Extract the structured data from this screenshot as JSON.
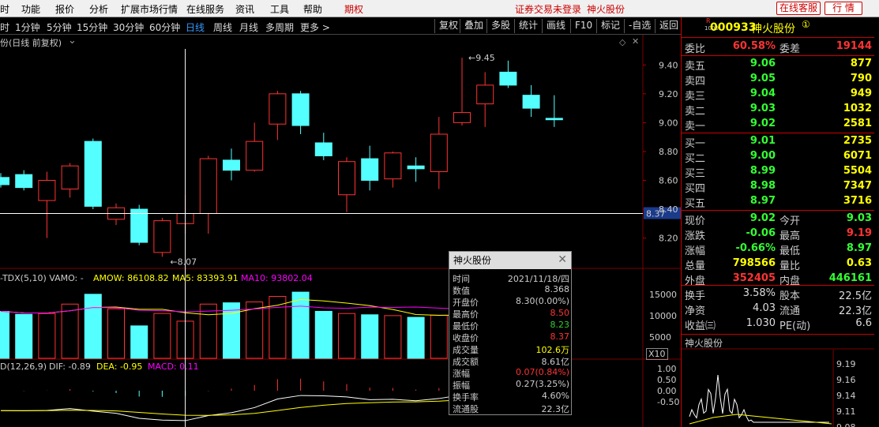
{
  "menu": {
    "items": [
      "时",
      "功能",
      "报价",
      "分析",
      "扩展市场行情",
      "在线服务",
      "资讯",
      "工具",
      "帮助"
    ],
    "qiquan": "期权",
    "status": "证券交易未登录",
    "stock_name": "神火股份",
    "service_btn": "在线客服",
    "quote_btn": "行 情"
  },
  "periods": {
    "items": [
      "时",
      "1分钟",
      "5分钟",
      "15分钟",
      "30分钟",
      "60分钟",
      "日线",
      "周线",
      "月线",
      "多周期",
      "更多 >"
    ],
    "active": "日线",
    "tools": [
      "复权",
      "叠加",
      "多股",
      "统计",
      "画线",
      "F10",
      "标记",
      "-自选",
      "返回"
    ]
  },
  "chart": {
    "title": "份(日线 前复权)",
    "price_ticks": [
      "9.40",
      "9.20",
      "9.00",
      "8.80",
      "8.60",
      "8.40",
      "8.20"
    ],
    "current_price_label": "8.37",
    "high_annotation": "9.45",
    "low_annotation": "8.07",
    "volume_ticks": [
      "15000",
      "10000",
      "5000"
    ],
    "volume_unit": "X10",
    "macd_ticks": [
      "1.00",
      "0.50",
      "0.00",
      "-0.50"
    ],
    "vol_indicator": {
      "name": "-TDX(5,10) VAMO: -",
      "amow": "AMOW: 86108.82",
      "ma5": "MA5: 83393.91",
      "ma10": "MA10: 93802.04"
    },
    "macd_indicator": {
      "name": "D(12,26,9)",
      "dif": "DIF: -0.89",
      "dea": "DEA: -0.95",
      "macd": "MACD: 0.11"
    }
  },
  "infobox": {
    "title": "神火股份",
    "rows": [
      {
        "k": "时间",
        "v": "2021/11/18/四",
        "color": "#cccccc"
      },
      {
        "k": "数值",
        "v": "8.368",
        "color": "#cccccc"
      },
      {
        "k": "开盘价",
        "v": "8.30(0.00%)",
        "color": "#cccccc"
      },
      {
        "k": "最高价",
        "v": "8.50",
        "color": "#ff3333"
      },
      {
        "k": "最低价",
        "v": "8.23",
        "color": "#33cc33"
      },
      {
        "k": "收盘价",
        "v": "8.37",
        "color": "#ff3333"
      },
      {
        "k": "成交量",
        "v": "102.6万",
        "color": "#ffff00"
      },
      {
        "k": "成交额",
        "v": "8.61亿",
        "color": "#cccccc"
      },
      {
        "k": "涨幅",
        "v": "0.07(0.84%)",
        "color": "#ff3333"
      },
      {
        "k": "振幅",
        "v": "0.27(3.25%)",
        "color": "#cccccc"
      },
      {
        "k": "换手率",
        "v": "4.60%",
        "color": "#cccccc"
      },
      {
        "k": "流通股",
        "v": "22.3亿",
        "color": "#cccccc"
      }
    ]
  },
  "quote": {
    "badge_top": "R",
    "badge_bottom": "1000",
    "code": "000933",
    "name": "神火股份",
    "circle": "①",
    "weibi_label": "委比",
    "weibi": "60.58%",
    "weicha_label": "委差",
    "weicha": "19144",
    "asks": [
      {
        "label": "卖五",
        "price": "9.06",
        "vol": "877"
      },
      {
        "label": "卖四",
        "price": "9.05",
        "vol": "790"
      },
      {
        "label": "卖三",
        "price": "9.04",
        "vol": "949"
      },
      {
        "label": "卖二",
        "price": "9.03",
        "vol": "1032"
      },
      {
        "label": "卖一",
        "price": "9.02",
        "vol": "2581"
      }
    ],
    "bids": [
      {
        "label": "买一",
        "price": "9.01",
        "vol": "2735"
      },
      {
        "label": "买二",
        "price": "9.00",
        "vol": "6071"
      },
      {
        "label": "买三",
        "price": "8.99",
        "vol": "5504"
      },
      {
        "label": "买四",
        "price": "8.98",
        "vol": "7347"
      },
      {
        "label": "买五",
        "price": "8.97",
        "vol": "3716"
      }
    ],
    "stats": [
      {
        "l1": "现价",
        "v1": "9.02",
        "c1": "#33ff33",
        "l2": "今开",
        "v2": "9.03",
        "c2": "#33ff33"
      },
      {
        "l1": "涨跌",
        "v1": "-0.06",
        "c1": "#33ff33",
        "l2": "最高",
        "v2": "9.19",
        "c2": "#ff3333"
      },
      {
        "l1": "涨幅",
        "v1": "-0.66%",
        "c1": "#33ff33",
        "l2": "最低",
        "v2": "8.97",
        "c2": "#33ff33"
      },
      {
        "l1": "总量",
        "v1": "798566",
        "c1": "#ffff00",
        "l2": "量比",
        "v2": "0.63",
        "c2": "#ffff00"
      },
      {
        "l1": "外盘",
        "v1": "352405",
        "c1": "#ff3333",
        "l2": "内盘",
        "v2": "446161",
        "c2": "#33ff33"
      }
    ],
    "stats2": [
      {
        "l1": "换手",
        "v1": "3.58%",
        "l2": "股本",
        "v2": "22.5亿"
      },
      {
        "l1": "净资",
        "v1": "4.03",
        "l2": "流通",
        "v2": "22.3亿"
      },
      {
        "l1": "收益㈢",
        "v1": "1.030",
        "l2": "PE(动)",
        "v2": "6.6"
      }
    ],
    "mini_title": "神火股份",
    "mini_ticks": [
      "9.19",
      "9.16",
      "9.14",
      "9.11",
      "9.08"
    ]
  },
  "colors": {
    "up": "#ff3333",
    "down": "#54ffff",
    "ma5": "#ffff00",
    "ma10": "#ff00ff",
    "amow": "#ffff00",
    "grid": "#7a0000"
  },
  "chart_data": {
    "type": "candlestick",
    "title": "份(日线 前复权)",
    "ylim": [
      8.05,
      9.5
    ],
    "candles": [
      {
        "open": 8.62,
        "close": 8.57,
        "high": 8.65,
        "low": 8.55
      },
      {
        "open": 8.64,
        "close": 8.55,
        "high": 8.67,
        "low": 8.53
      },
      {
        "open": 8.46,
        "close": 8.6,
        "high": 8.66,
        "low": 8.2
      },
      {
        "open": 8.54,
        "close": 8.7,
        "high": 8.72,
        "low": 8.48
      },
      {
        "open": 8.87,
        "close": 8.42,
        "high": 8.89,
        "low": 8.4
      },
      {
        "open": 8.33,
        "close": 8.41,
        "high": 8.44,
        "low": 8.29
      },
      {
        "open": 8.4,
        "close": 8.17,
        "high": 8.43,
        "low": 8.15
      },
      {
        "open": 8.1,
        "close": 8.32,
        "high": 8.34,
        "low": 8.07
      },
      {
        "open": 8.3,
        "close": 8.37,
        "high": 8.5,
        "low": 8.23
      },
      {
        "open": 8.37,
        "close": 8.75,
        "high": 8.77,
        "low": 8.23
      },
      {
        "open": 8.74,
        "close": 8.67,
        "high": 8.82,
        "low": 8.6
      },
      {
        "open": 8.67,
        "close": 8.87,
        "high": 9.0,
        "low": 8.66
      },
      {
        "open": 8.99,
        "close": 9.2,
        "high": 9.22,
        "low": 8.88
      },
      {
        "open": 9.2,
        "close": 8.98,
        "high": 9.22,
        "low": 8.92
      },
      {
        "open": 8.86,
        "close": 8.77,
        "high": 8.93,
        "low": 8.74
      },
      {
        "open": 8.5,
        "close": 8.73,
        "high": 8.76,
        "low": 8.38
      },
      {
        "open": 8.75,
        "close": 8.6,
        "high": 8.84,
        "low": 8.53
      },
      {
        "open": 8.61,
        "close": 8.79,
        "high": 8.8,
        "low": 8.55
      },
      {
        "open": 8.7,
        "close": 8.68,
        "high": 8.76,
        "low": 8.59
      },
      {
        "open": 8.66,
        "close": 8.92,
        "high": 9.04,
        "low": 8.54
      },
      {
        "open": 9.0,
        "close": 9.07,
        "high": 9.45,
        "low": 8.98
      },
      {
        "open": 9.13,
        "close": 9.26,
        "high": 9.35,
        "low": 8.97
      },
      {
        "open": 9.35,
        "close": 9.26,
        "high": 9.43,
        "low": 9.24
      },
      {
        "open": 9.19,
        "close": 9.1,
        "high": 9.26,
        "low": 9.04
      },
      {
        "open": 9.03,
        "close": 9.02,
        "high": 9.19,
        "low": 8.97
      }
    ],
    "volume": [
      11000,
      10300,
      10500,
      12700,
      15000,
      11600,
      7600,
      10500,
      8700,
      12700,
      13000,
      13200,
      14500,
      15500,
      11000,
      10500,
      10200,
      10000,
      9600,
      10100,
      10700,
      13600,
      14000,
      11000,
      8000
    ],
    "volume_ylim": [
      0,
      17000
    ],
    "current_price": 8.37
  }
}
